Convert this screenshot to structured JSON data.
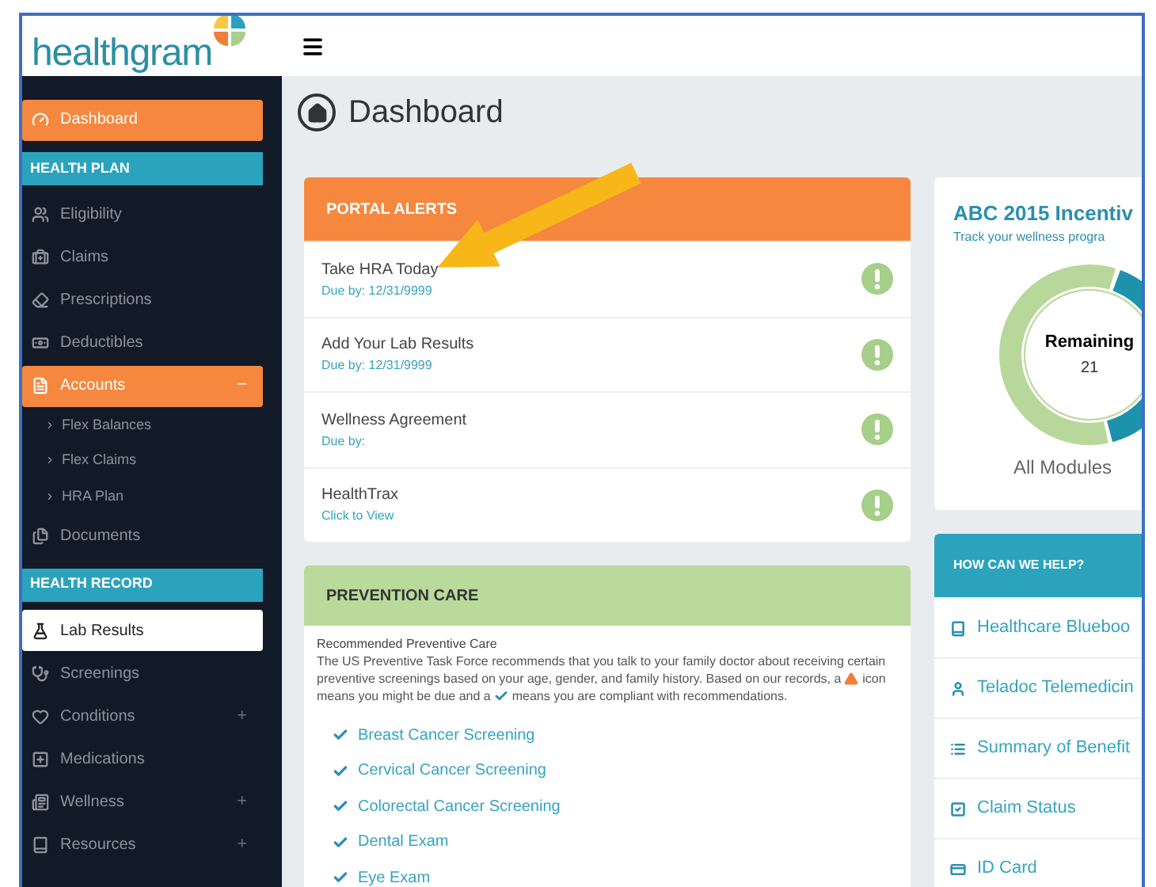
{
  "logo": {
    "text": "healthgram"
  },
  "sidebar": {
    "items": [
      {
        "kind": "item",
        "label": "Dashboard",
        "highlighted": true,
        "selected": false
      },
      {
        "kind": "header",
        "label": "HEALTH PLAN"
      },
      {
        "kind": "item",
        "label": "Eligibility",
        "highlighted": false,
        "selected": false
      },
      {
        "kind": "item",
        "label": "Claims",
        "highlighted": false,
        "selected": false
      },
      {
        "kind": "item",
        "label": "Prescriptions",
        "highlighted": false,
        "selected": false
      },
      {
        "kind": "item",
        "label": "Deductibles",
        "highlighted": false,
        "selected": false
      },
      {
        "kind": "item",
        "label": "Accounts",
        "highlighted": true,
        "selected": false,
        "toggle": "−",
        "expanded": true,
        "children": [
          {
            "label": "Flex Balances"
          },
          {
            "label": "Flex Claims"
          },
          {
            "label": "HRA Plan"
          }
        ]
      },
      {
        "kind": "item",
        "label": "Documents",
        "highlighted": false,
        "selected": false
      },
      {
        "kind": "header",
        "label": "HEALTH RECORD"
      },
      {
        "kind": "item",
        "label": "Lab Results",
        "highlighted": false,
        "selected": true
      },
      {
        "kind": "item",
        "label": "Screenings",
        "highlighted": false,
        "selected": false
      },
      {
        "kind": "item",
        "label": "Conditions",
        "highlighted": false,
        "selected": false,
        "toggle": "+",
        "expanded": false
      },
      {
        "kind": "item",
        "label": "Medications",
        "highlighted": false,
        "selected": false
      },
      {
        "kind": "item",
        "label": "Wellness",
        "highlighted": false,
        "selected": false,
        "toggle": "+",
        "expanded": false
      },
      {
        "kind": "item",
        "label": "Resources",
        "highlighted": false,
        "selected": false,
        "toggle": "+",
        "expanded": false
      }
    ]
  },
  "page": {
    "title": "Dashboard"
  },
  "portal_alerts": {
    "title": "PORTAL ALERTS",
    "alerts": [
      {
        "title": "Take HRA Today",
        "subtitle": "Due by: 12/31/9999"
      },
      {
        "title": "Add Your Lab Results",
        "subtitle": "Due by: 12/31/9999"
      },
      {
        "title": "Wellness Agreement",
        "subtitle": "Due by:"
      },
      {
        "title": "HealthTrax",
        "subtitle": "Click to View"
      }
    ]
  },
  "prevention_care": {
    "title": "PREVENTION CARE",
    "subtitle": "Recommended Preventive Care",
    "text_before_warning": "The US Preventive Task Force recommends that you talk to your family doctor about receiving certain preventive screenings based on your age, gender, and family history. Based on our records, a",
    "text_between": "icon means you might be due and a",
    "text_after": "means you are compliant with recommendations.",
    "items": [
      {
        "label": "Breast Cancer Screening"
      },
      {
        "label": "Cervical Cancer Screening"
      },
      {
        "label": "Colorectal Cancer Screening"
      },
      {
        "label": "Dental Exam"
      },
      {
        "label": "Eye Exam"
      }
    ]
  },
  "incentive": {
    "title": "ABC 2015 Incentiv",
    "subtitle": "Track your wellness progra",
    "center_label": "Remaining",
    "center_value": "21",
    "footer": "All Modules"
  },
  "help": {
    "title": "HOW CAN WE HELP?",
    "links": [
      {
        "label": "Healthcare Blueboo"
      },
      {
        "label": "Teladoc Telemedicin"
      },
      {
        "label": "Summary of Benefit"
      },
      {
        "label": "Claim Status"
      },
      {
        "label": "ID Card"
      }
    ]
  }
}
